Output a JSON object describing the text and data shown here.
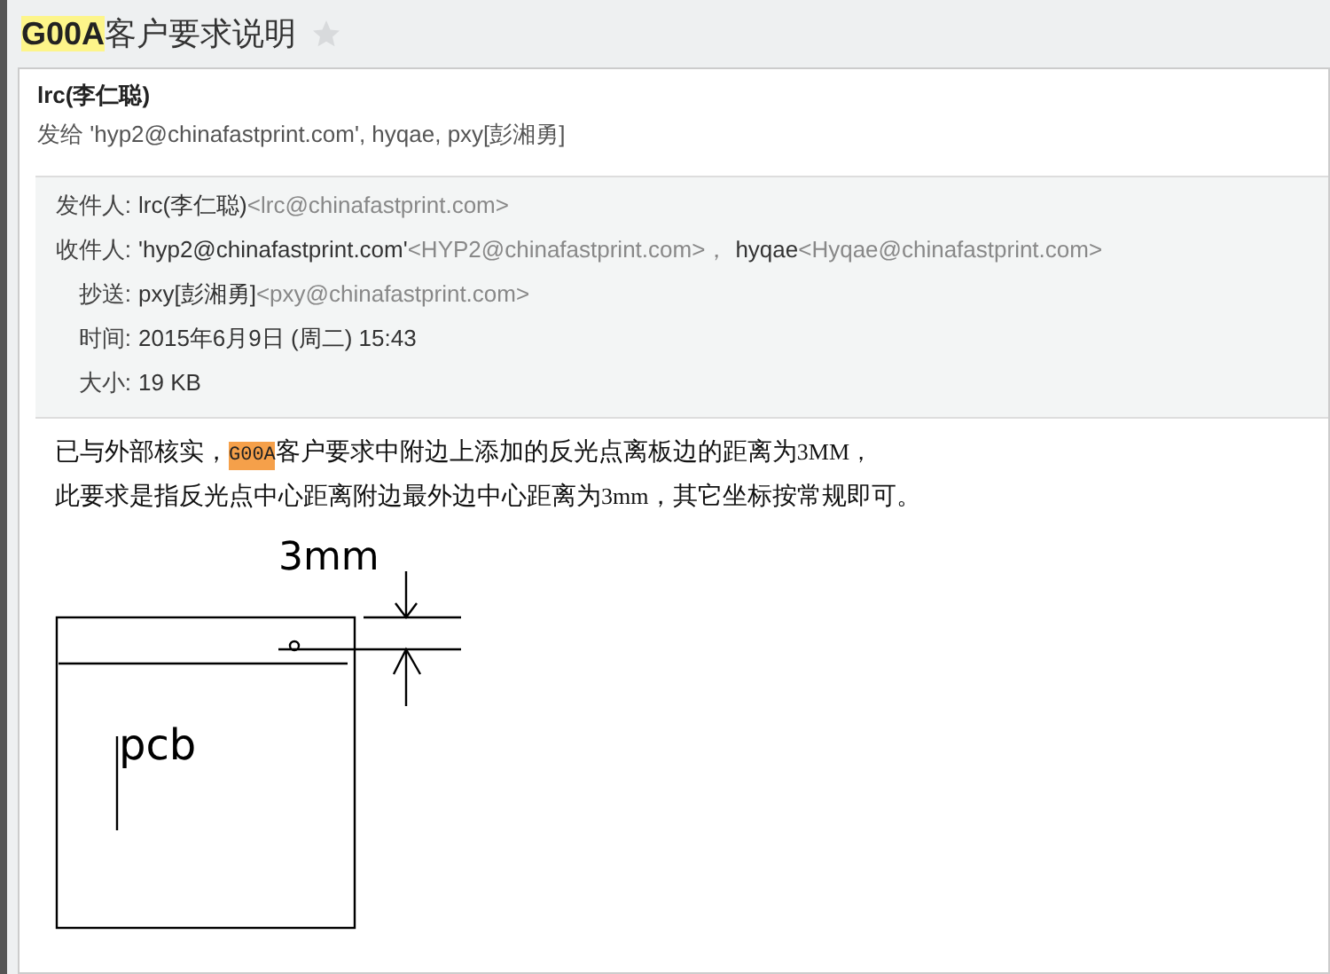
{
  "subject": {
    "segments": [
      {
        "kind": "highlight",
        "text": "G00A"
      },
      {
        "kind": "plain",
        "text": "客户要求说明"
      }
    ],
    "starred": false
  },
  "sender": "lrc(李仁聪)",
  "sent_to": "发给 'hyp2@chinafastprint.com', hyqae, pxy[彭湘勇]",
  "header_rows": [
    {
      "kind": "contacts",
      "label": "发件人:",
      "contacts": [
        {
          "name": "lrc(李仁聪)",
          "address": "<lrc@chinafastprint.com>"
        }
      ]
    },
    {
      "kind": "contacts",
      "label": "收件人:",
      "contacts": [
        {
          "name": "'hyp2@chinafastprint.com'",
          "address": "<HYP2@chinafastprint.com>，"
        },
        {
          "name": "hyqae",
          "address": "<Hyqae@chinafastprint.com>"
        }
      ]
    },
    {
      "kind": "contacts",
      "label": "抄送:",
      "contacts": [
        {
          "name": "pxy[彭湘勇]",
          "address": "<pxy@chinafastprint.com>"
        }
      ]
    },
    {
      "kind": "text",
      "label": "时间:",
      "value": "2015年6月9日 (周二) 15:43"
    },
    {
      "kind": "text",
      "label": "大小:",
      "value": "19 KB"
    }
  ],
  "body_lines": [
    [
      {
        "kind": "plain",
        "text": "已与外部核实，"
      },
      {
        "kind": "highlight",
        "text": "G00A"
      },
      {
        "kind": "plain",
        "text": "客户要求中附边上添加的反光点离板边的距离为"
      },
      {
        "kind": "serif",
        "text": "3MM，"
      }
    ],
    [
      {
        "kind": "plain",
        "text": "此要求是指反光点中心距离附边最外边中心距离为"
      },
      {
        "kind": "serif",
        "text": "3mm"
      },
      {
        "kind": "plain",
        "text": "，其它坐标按常规即可。"
      }
    ]
  ],
  "sketch": {
    "dimension_label": "3mm",
    "board_label": "pcb"
  }
}
